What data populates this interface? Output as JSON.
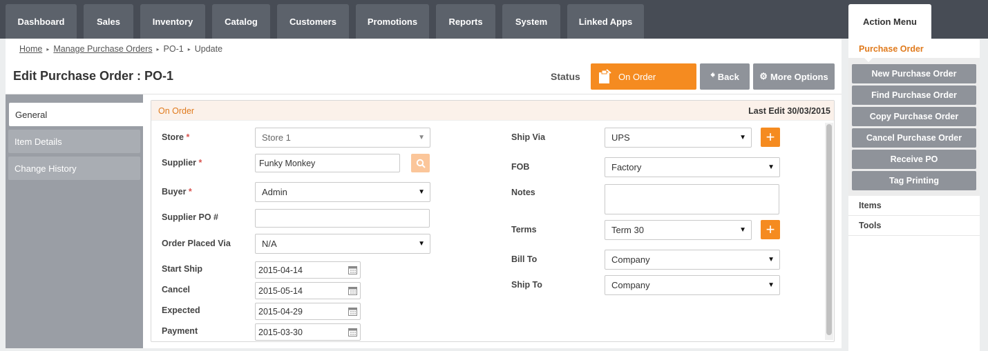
{
  "nav": {
    "tabs": [
      "Dashboard",
      "Sales",
      "Inventory",
      "Catalog",
      "Customers",
      "Promotions",
      "Reports",
      "System",
      "Linked Apps"
    ],
    "action_menu": "Action Menu"
  },
  "breadcrumb": {
    "home": "Home",
    "manage": "Manage Purchase Orders",
    "po": "PO-1",
    "current": "Update"
  },
  "header": {
    "title": "Edit Purchase Order : PO-1",
    "status_label": "Status",
    "status_value": "On Order",
    "back": "Back",
    "more_options": "More Options"
  },
  "sidenav": [
    "General",
    "Item Details",
    "Change History"
  ],
  "panel": {
    "state": "On Order",
    "last_edit": "Last Edit 30/03/2015"
  },
  "form": {
    "store_label": "Store",
    "store_value": "Store 1",
    "supplier_label": "Supplier",
    "supplier_value": "Funky Monkey",
    "buyer_label": "Buyer",
    "buyer_value": "Admin",
    "supplier_po_label": "Supplier PO #",
    "supplier_po_value": "",
    "order_placed_label": "Order Placed Via",
    "order_placed_value": "N/A",
    "start_ship_label": "Start Ship",
    "start_ship_value": "2015-04-14",
    "cancel_label": "Cancel",
    "cancel_value": "2015-05-14",
    "expected_label": "Expected",
    "expected_value": "2015-04-29",
    "payment_label": "Payment",
    "payment_value": "2015-03-30",
    "ship_via_label": "Ship Via",
    "ship_via_value": "UPS",
    "fob_label": "FOB",
    "fob_value": "Factory",
    "notes_label": "Notes",
    "notes_value": "",
    "terms_label": "Terms",
    "terms_value": "Term 30",
    "bill_to_label": "Bill To",
    "bill_to_value": "Company",
    "ship_to_label": "Ship To",
    "ship_to_value": "Company",
    "required_mark": "*"
  },
  "action_menu": {
    "section": "Purchase Order",
    "buttons": [
      "New Purchase Order",
      "Find Purchase Order",
      "Copy Purchase Order",
      "Cancel Purchase Order",
      "Receive PO",
      "Tag Printing"
    ],
    "items": [
      "Items",
      "Tools"
    ]
  },
  "colors": {
    "accent": "#f58b20",
    "nav": "#474c55",
    "button_grey": "#8f939a"
  }
}
